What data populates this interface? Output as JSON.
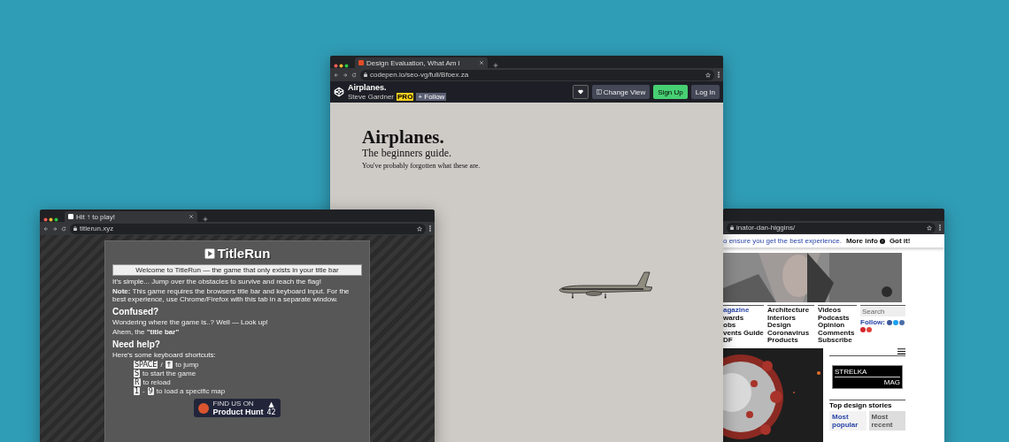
{
  "codepen_window": {
    "tab": {
      "title": "Design Evaluation, What Am I"
    },
    "url": "codepen.io/seo-vg/full/Bfoex.za",
    "header": {
      "title": "Airplanes.",
      "author": "Steve Gardner",
      "badge": "PRO",
      "follow": "+ Follow",
      "buttons": [
        {
          "kind": "heart"
        },
        {
          "kind": "view",
          "label": "Change View"
        },
        {
          "kind": "signup",
          "label": "Sign Up"
        },
        {
          "kind": "login",
          "label": "Log In"
        }
      ]
    },
    "page": {
      "heading": "Airplanes.",
      "subheading": "The beginners guide.",
      "tagline": "You've probably forgotten what these are."
    }
  },
  "titlerun_window": {
    "tab": {
      "title": "Hit ↑ to play!"
    },
    "url": "titlerun.xyz",
    "panel": {
      "logo": "TitleRun",
      "welcome": "Welcome to TitleRun — the game that only exists in your title bar",
      "blocks": [
        {
          "kind": "paragraph",
          "text": "It's simple... Jump over the obstacles to survive and reach the flag!"
        },
        {
          "kind": "paragraph",
          "text": "**Note:** This game requires the browsers title bar and keyboard input. For the best experience, use Chrome/Firefox with this tab in a separate window."
        },
        {
          "kind": "heading",
          "text": "Confused?"
        },
        {
          "kind": "paragraph",
          "text": "Wondering where the game is..? Well — Look up!"
        },
        {
          "kind": "paragraph",
          "text": "Ahem, the **\"title bar\"**"
        },
        {
          "kind": "heading",
          "text": "Need help?"
        },
        {
          "kind": "paragraph",
          "text": "Here's some keyboard shortcuts:"
        },
        {
          "kind": "shortcuts",
          "items": [
            {
              "keys": [
                "SPACE",
                "↑"
              ],
              "separator": "/",
              "action": "to jump"
            },
            {
              "keys": [
                "S"
              ],
              "action": "to start the game"
            },
            {
              "keys": [
                "R"
              ],
              "action": "to reload"
            },
            {
              "keys": [
                "1",
                "9"
              ],
              "separator": "-",
              "action": "to load a specific map"
            }
          ]
        },
        {
          "kind": "badge",
          "small": "FIND US ON",
          "name": "Product Hunt",
          "arrow": "▲",
          "count": "42"
        }
      ]
    }
  },
  "dezeen_window": {
    "url": "inator-dan-higgins/",
    "cookie": {
      "text": "o ensure you get the best experience.",
      "more": "More info",
      "accept": "Got it!"
    },
    "nav_columns": [
      [
        "agazine",
        "wards",
        "obs",
        "vents Guide",
        "DF"
      ],
      [
        "Architecture",
        "Interiors",
        "Design",
        "Coronavirus",
        "Products"
      ],
      [
        "Videos",
        "Podcasts",
        "Opinion",
        "Comments",
        "Subscribe"
      ]
    ],
    "search": {
      "placeholder": "Search"
    },
    "follow": "Follow:",
    "social": [
      {
        "color": "#3b5998"
      },
      {
        "color": "#1da1f2"
      },
      {
        "color": "#4a6ea9"
      },
      {
        "color": "#d3262b"
      },
      {
        "color": "#e0413a"
      }
    ],
    "ad": {
      "top": "STRELKA",
      "bottom": "MAG"
    },
    "stories": {
      "title": "Top design stories",
      "tabs": [
        {
          "label": "Most popular",
          "selected": true
        },
        {
          "label": "Most recent",
          "selected": false
        }
      ]
    }
  }
}
